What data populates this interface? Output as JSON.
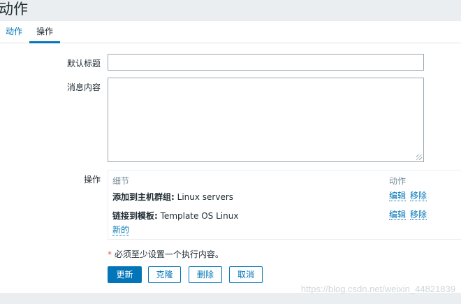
{
  "page": {
    "title": "动作"
  },
  "tabs": [
    {
      "label": "动作",
      "active": false
    },
    {
      "label": "操作",
      "active": true
    }
  ],
  "form": {
    "default_subject_label": "默认标题",
    "default_subject_value": "",
    "message_label": "消息内容",
    "message_value": "",
    "operations_label": "操作"
  },
  "operations": {
    "col_details": "细节",
    "col_action": "动作",
    "rows": [
      {
        "prefix": "添加到主机群组:",
        "value": "Linux servers",
        "edit": "编辑",
        "remove": "移除"
      },
      {
        "prefix": "链接到模板:",
        "value": "Template OS Linux",
        "edit": "编辑",
        "remove": "移除"
      }
    ],
    "new_link": "新的"
  },
  "required_note": {
    "star": "*",
    "text": "必须至少设置一个执行内容。"
  },
  "buttons": {
    "update": "更新",
    "clone": "克隆",
    "delete": "删除",
    "cancel": "取消"
  },
  "watermark": "https://blog.csdn.net/weixin_44821839",
  "colors": {
    "accent": "#0275b8",
    "header_bg": "#ebeef0",
    "required": "#e45959"
  }
}
